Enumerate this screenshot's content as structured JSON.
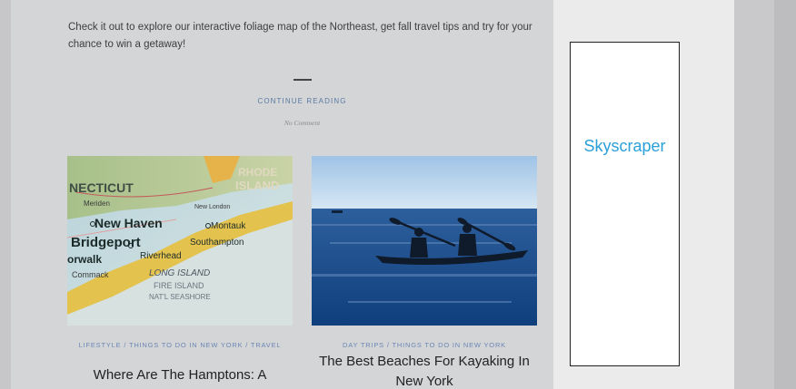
{
  "article": {
    "intro": "Check it out to explore our interactive foliage map of the Northeast, get fall travel tips and try for your chance to win a getaway!",
    "continue_label": "CONTINUE READING",
    "comment_label": "No Comment"
  },
  "cards": [
    {
      "categories": "LIFESTYLE  / THINGS TO DO IN NEW YORK  / TRAVEL",
      "title": "Where Are The Hamptons: A",
      "image": {
        "labels": [
          "NECTICUT",
          "RHODE",
          "ISLAND",
          "New Haven",
          "Montauk",
          "Bridgeport",
          "Southampton",
          "orwalk",
          "Riverhead",
          "Commack",
          "LONG ISLAND",
          "FIRE ISLAND",
          "NAT'L SEASHORE",
          "Meriden",
          "New London"
        ]
      }
    },
    {
      "categories": "DAY TRIPS  / THINGS TO DO IN NEW YORK",
      "title": "The Best Beaches For Kayaking In New York"
    }
  ],
  "ad": {
    "label": "Skyscraper"
  },
  "colors": {
    "accent": "#5b7aa3",
    "ad_text": "#2aa0d8"
  }
}
